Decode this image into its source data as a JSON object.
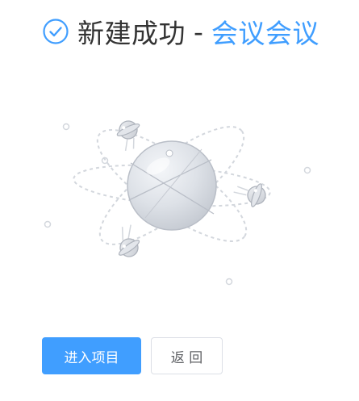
{
  "result": {
    "status_icon": "check-circle-icon",
    "title": "新建成功",
    "separator": "-",
    "item_name": "会议会议",
    "accent_color": "#409eff"
  },
  "illustration": {
    "icon": "atom-planet-illustration"
  },
  "actions": {
    "primary_label": "进入项目",
    "back_label": "返 回"
  }
}
